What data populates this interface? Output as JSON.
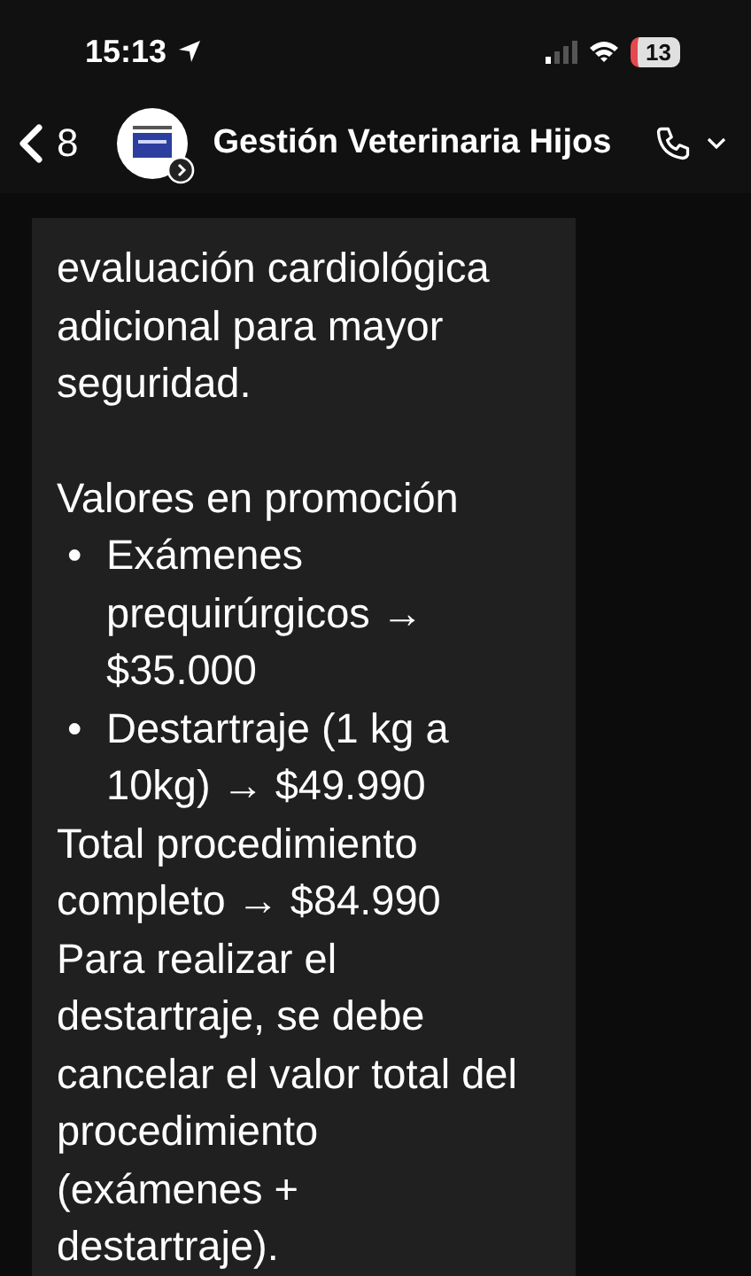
{
  "status_bar": {
    "time": "15:13",
    "battery": "13"
  },
  "header": {
    "back_count": "8",
    "title": "Gestión Veterinaria Hijos"
  },
  "message": {
    "blocks": [
      {
        "kind": "paragraph",
        "text": "evaluación cardiológica adicional para mayor seguridad."
      },
      {
        "kind": "spacer"
      },
      {
        "kind": "paragraph",
        "text": "Valores en promoción"
      },
      {
        "kind": "bullets",
        "items": [
          {
            "marker": "•",
            "text": "Exámenes prequirúrgicos → $35.000"
          },
          {
            "marker": "•",
            "text": "Destartraje (1 kg a 10kg) → $49.990"
          }
        ]
      },
      {
        "kind": "paragraph",
        "text": "Total procedimiento completo → $84.990"
      },
      {
        "kind": "paragraph",
        "text": "Para realizar el destartraje, se debe cancelar el valor total del procedimiento (exámenes + destartraje)."
      }
    ]
  }
}
